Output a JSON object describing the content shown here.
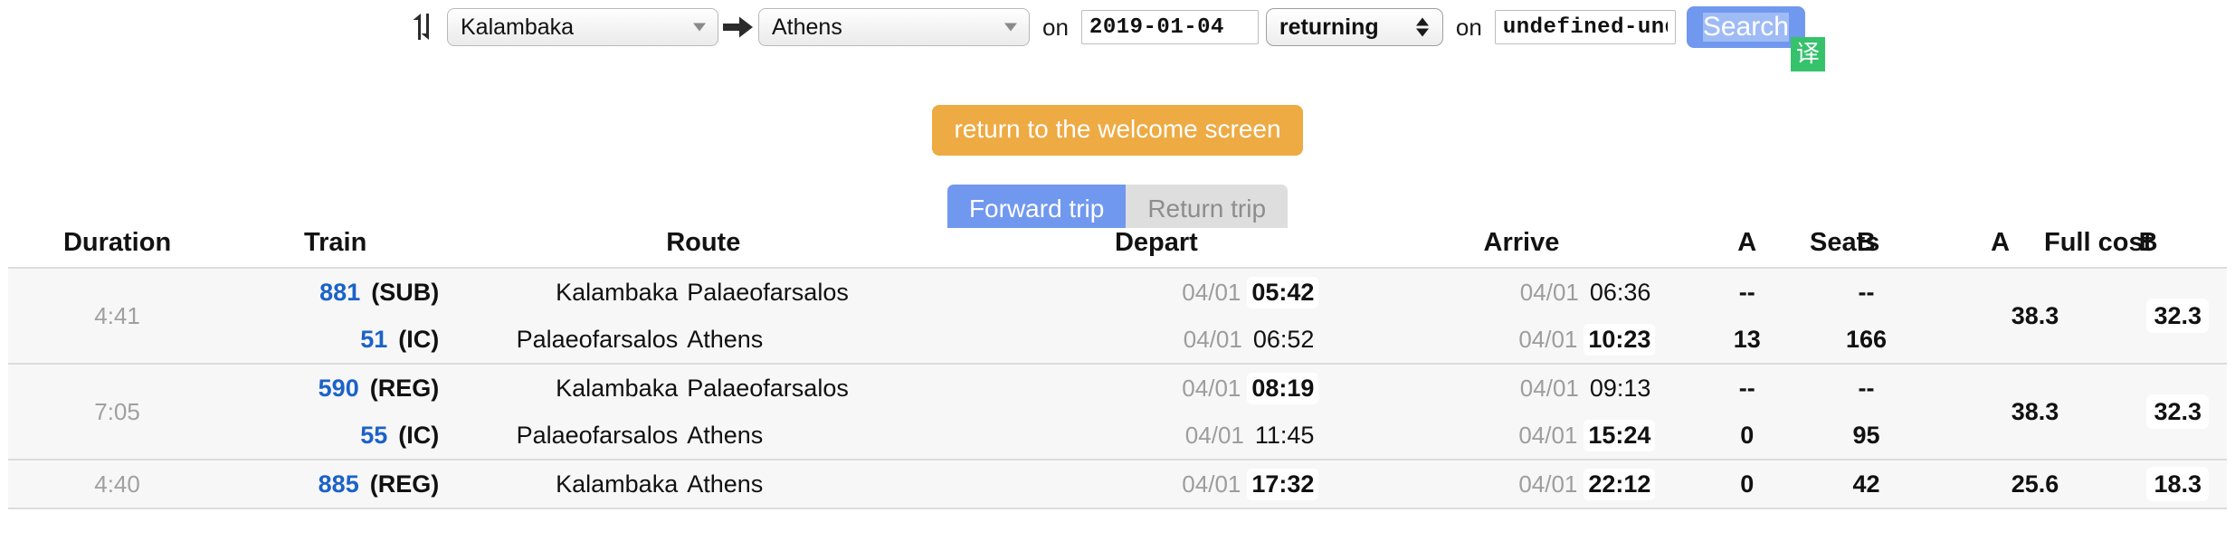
{
  "search": {
    "swap_icon": "swap-vertical-icon",
    "arrow_icon": "arrow-right-icon",
    "origin": "Kalambaka",
    "destination": "Athens",
    "on_label_1": "on",
    "on_label_2": "on",
    "date_out": "2019-01-04",
    "date_return": "undefined-undefined-undefined",
    "direction": "returning",
    "search_label": "Search",
    "translate_badge": "译"
  },
  "actions": {
    "welcome_label": "return to the welcome screen",
    "tab_forward": "Forward trip",
    "tab_return": "Return trip"
  },
  "colors": {
    "accent_blue": "#7198ef",
    "train_link": "#1b62c8",
    "orange": "#eeaa43",
    "translate_green": "#35c26b",
    "row_bg": "#f7f7f7",
    "muted": "#a0a0a0"
  },
  "table": {
    "group_headers": {
      "seats": "Seats",
      "full_cost": "Full cost"
    },
    "headers": {
      "duration": "Duration",
      "train": "Train",
      "route": "Route",
      "depart": "Depart",
      "arrive": "Arrive",
      "seats_a": "A",
      "seats_b": "B",
      "cost_a": "A",
      "cost_b": "B"
    },
    "rows": [
      {
        "duration": "4:41",
        "cost_a": "38.3",
        "cost_b": "32.3",
        "legs": [
          {
            "train_no": "881",
            "train_cat": "(SUB)",
            "from": "Kalambaka",
            "to": "Palaeofarsalos",
            "depart_date": "04/01",
            "depart_time": "05:42",
            "depart_hl": true,
            "arrive_date": "04/01",
            "arrive_time": "06:36",
            "arrive_hl": false,
            "seats_a": "--",
            "seats_b": "--"
          },
          {
            "train_no": "51",
            "train_cat": "(IC)",
            "from": "Palaeofarsalos",
            "to": "Athens",
            "depart_date": "04/01",
            "depart_time": "06:52",
            "depart_hl": false,
            "arrive_date": "04/01",
            "arrive_time": "10:23",
            "arrive_hl": true,
            "seats_a": "13",
            "seats_b": "166"
          }
        ]
      },
      {
        "duration": "7:05",
        "cost_a": "38.3",
        "cost_b": "32.3",
        "legs": [
          {
            "train_no": "590",
            "train_cat": "(REG)",
            "from": "Kalambaka",
            "to": "Palaeofarsalos",
            "depart_date": "04/01",
            "depart_time": "08:19",
            "depart_hl": true,
            "arrive_date": "04/01",
            "arrive_time": "09:13",
            "arrive_hl": false,
            "seats_a": "--",
            "seats_b": "--"
          },
          {
            "train_no": "55",
            "train_cat": "(IC)",
            "from": "Palaeofarsalos",
            "to": "Athens",
            "depart_date": "04/01",
            "depart_time": "11:45",
            "depart_hl": false,
            "arrive_date": "04/01",
            "arrive_time": "15:24",
            "arrive_hl": true,
            "seats_a": "0",
            "seats_b": "95"
          }
        ]
      },
      {
        "duration": "4:40",
        "cost_a": "25.6",
        "cost_b": "18.3",
        "legs": [
          {
            "train_no": "885",
            "train_cat": "(REG)",
            "from": "Kalambaka",
            "to": "Athens",
            "depart_date": "04/01",
            "depart_time": "17:32",
            "depart_hl": true,
            "arrive_date": "04/01",
            "arrive_time": "22:12",
            "arrive_hl": true,
            "seats_a": "0",
            "seats_b": "42"
          }
        ]
      }
    ]
  }
}
